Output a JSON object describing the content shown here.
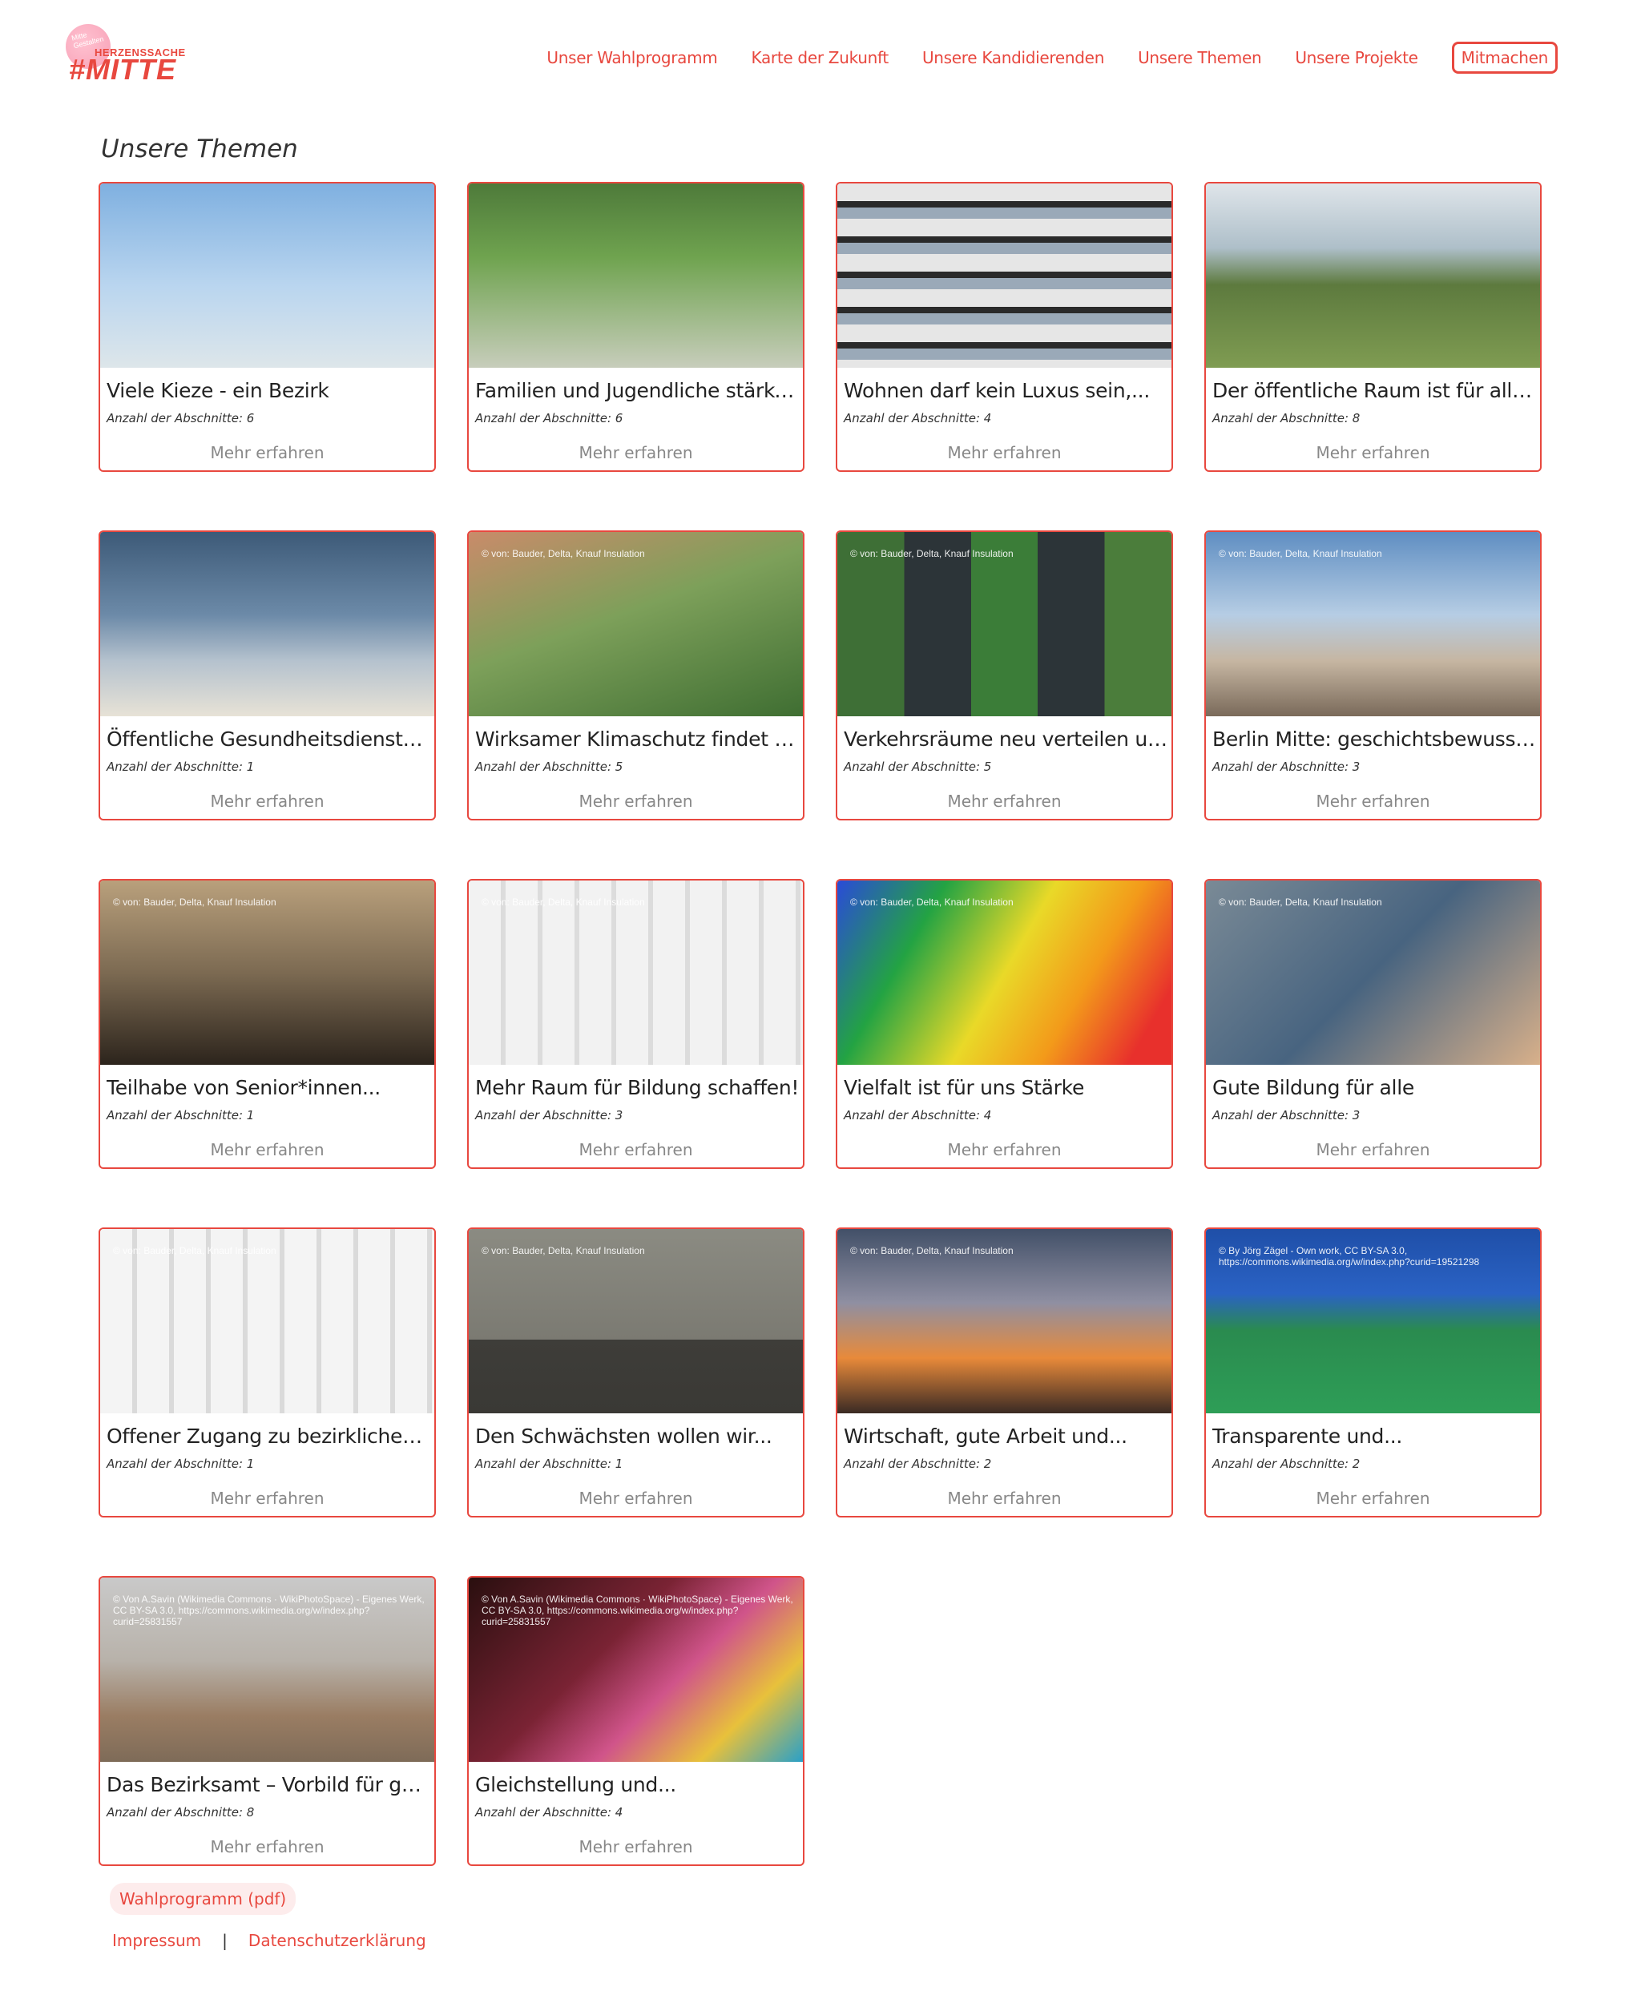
{
  "logo": {
    "tagline": "Mitte\nGestalten",
    "small": "HERZENSSACHE",
    "big": "#MITTE"
  },
  "nav": {
    "items": [
      {
        "label": "Unser Wahlprogramm"
      },
      {
        "label": "Karte der Zukunft"
      },
      {
        "label": "Unsere Kandidierenden"
      },
      {
        "label": "Unsere Themen"
      },
      {
        "label": "Unsere Projekte"
      }
    ],
    "cta": "Mitmachen"
  },
  "page_title": "Unsere Themen",
  "cards": [
    {
      "title": "Viele Kieze - ein Bezirk",
      "count": "Anzahl der Abschnitte: 6",
      "more": "Mehr erfahren",
      "credit": ""
    },
    {
      "title": "Familien und Jugendliche stärken!",
      "count": "Anzahl der Abschnitte: 6",
      "more": "Mehr erfahren",
      "credit": ""
    },
    {
      "title": "Wohnen darf kein Luxus sein,...",
      "count": "Anzahl der Abschnitte: 4",
      "more": "Mehr erfahren",
      "credit": ""
    },
    {
      "title": "Der öffentliche Raum ist für alle...",
      "count": "Anzahl der Abschnitte: 8",
      "more": "Mehr erfahren",
      "credit": ""
    },
    {
      "title": "Öffentliche Gesundheitsdienste...",
      "count": "Anzahl der Abschnitte: 1",
      "more": "Mehr erfahren",
      "credit": ""
    },
    {
      "title": "Wirksamer Klimaschutz findet vo...",
      "count": "Anzahl der Abschnitte: 5",
      "more": "Mehr erfahren",
      "credit": "© von: Bauder, Delta, Knauf Insulation"
    },
    {
      "title": "Verkehrsräume neu verteilen und...",
      "count": "Anzahl der Abschnitte: 5",
      "more": "Mehr erfahren",
      "credit": "© von: Bauder, Delta, Knauf Insulation"
    },
    {
      "title": "Berlin Mitte: geschichtsbewusst...",
      "count": "Anzahl der Abschnitte: 3",
      "more": "Mehr erfahren",
      "credit": "© von: Bauder, Delta, Knauf Insulation"
    },
    {
      "title": "Teilhabe von Senior*innen...",
      "count": "Anzahl der Abschnitte: 1",
      "more": "Mehr erfahren",
      "credit": "© von: Bauder, Delta, Knauf Insulation"
    },
    {
      "title": "Mehr Raum für Bildung schaffen!",
      "count": "Anzahl der Abschnitte: 3",
      "more": "Mehr erfahren",
      "credit": "© von: Bauder, Delta, Knauf Insulation"
    },
    {
      "title": "Vielfalt ist für uns Stärke",
      "count": "Anzahl der Abschnitte: 4",
      "more": "Mehr erfahren",
      "credit": "© von: Bauder, Delta, Knauf Insulation"
    },
    {
      "title": "Gute Bildung für alle",
      "count": "Anzahl der Abschnitte: 3",
      "more": "Mehr erfahren",
      "credit": "© von: Bauder, Delta, Knauf Insulation"
    },
    {
      "title": "Offener Zugang zu bezirklichen...",
      "count": "Anzahl der Abschnitte: 1",
      "more": "Mehr erfahren",
      "credit": "© von: Bauder, Delta, Knauf Insulation"
    },
    {
      "title": "Den Schwächsten wollen wir...",
      "count": "Anzahl der Abschnitte: 1",
      "more": "Mehr erfahren",
      "credit": "© von: Bauder, Delta, Knauf Insulation"
    },
    {
      "title": "Wirtschaft, gute Arbeit und...",
      "count": "Anzahl der Abschnitte: 2",
      "more": "Mehr erfahren",
      "credit": "© von: Bauder, Delta, Knauf Insulation"
    },
    {
      "title": "Transparente und...",
      "count": "Anzahl der Abschnitte: 2",
      "more": "Mehr erfahren",
      "credit": "© By Jörg Zägel - Own work, CC BY-SA 3.0, https://commons.wikimedia.org/w/index.php?curid=19521298"
    },
    {
      "title": "Das Bezirksamt – Vorbild für gut...",
      "count": "Anzahl der Abschnitte: 8",
      "more": "Mehr erfahren",
      "credit": "© Von A.Savin (Wikimedia Commons · WikiPhotoSpace) - Eigenes Werk, CC BY-SA 3.0, https://commons.wikimedia.org/w/index.php?curid=25831557"
    },
    {
      "title": "Gleichstellung und...",
      "count": "Anzahl der Abschnitte: 4",
      "more": "Mehr erfahren",
      "credit": "© Von A.Savin (Wikimedia Commons · WikiPhotoSpace) - Eigenes Werk, CC BY-SA 3.0, https://commons.wikimedia.org/w/index.php?curid=25831557"
    }
  ],
  "footer": {
    "pdf_label": "Wahlprogramm (pdf)",
    "impressum": "Impressum",
    "separator": "|",
    "datenschutz": "Datenschutzerklärung"
  },
  "colors": {
    "accent": "#e8483f",
    "pill_bg": "#fdecec"
  }
}
